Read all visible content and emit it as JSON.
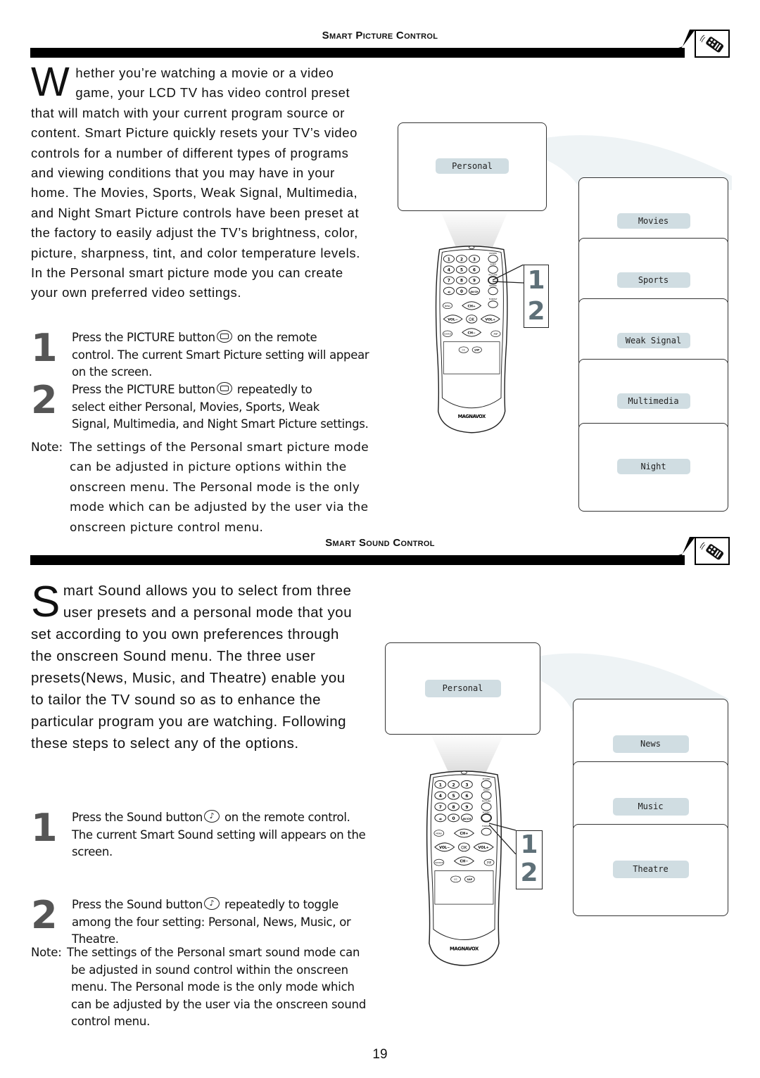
{
  "sections": {
    "picture": {
      "title": "Smart Picture Control",
      "intro_dropcap": "W",
      "intro_lines": [
        "hether you’re watching a movie or a video",
        "game, your LCD TV has video control preset",
        "that will match with your current program source or",
        "content. Smart Picture quickly resets your TV’s video",
        "controls for a number of different types of programs",
        "and viewing conditions that you may have in your",
        "home. The Movies, Sports, Weak Signal, Multimedia,",
        "and Night Smart Picture controls have been preset at",
        "the factory to easily adjust the TV’s brightness, color,",
        "picture, sharpness, tint, and color temperature levels.",
        "In the Personal smart picture mode you can create",
        "your own preferred video settings."
      ],
      "steps": [
        {
          "number": "1",
          "line1_before": "Press the PICTURE button",
          "line1_after": "on the remote",
          "rest": [
            "control. The current Smart Picture setting will appear",
            "on the screen."
          ]
        },
        {
          "number": "2",
          "line1_before": "Press the PICTURE button",
          "line1_after": "repeatedly to",
          "rest": [
            "select either Personal, Movies, Sports, Weak",
            "Signal, Multimedia, and Night Smart Picture settings."
          ]
        }
      ],
      "note_label": "Note:",
      "note_lines": [
        "The settings of the Personal smart picture mode",
        "can be adjusted in picture options within the",
        "onscreen menu. The Personal mode is the only",
        "mode which can be adjusted by the user via the",
        "onscreen picture control menu."
      ],
      "current_screen": "Personal",
      "options": [
        "Movies",
        "Sports",
        "Weak Signal",
        "Multimedia",
        "Night"
      ],
      "callout_numbers": [
        "1",
        "2"
      ],
      "button_icon": "picture-button-icon"
    },
    "sound": {
      "title": "Smart Sound Control",
      "intro_dropcap": "S",
      "intro_lines": [
        "mart Sound allows you to select from three",
        "user presets and a personal mode that you",
        "set according to you own preferences through",
        "the onscreen Sound menu. The three user",
        "presets(News, Music, and Theatre) enable you",
        "to tailor the TV sound so as to enhance the",
        "particular program you are watching. Following",
        "these steps to select any of the options."
      ],
      "steps": [
        {
          "number": "1",
          "line1_before": "Press the Sound button",
          "line1_after": "on the remote control.",
          "rest": [
            "The current Smart Sound setting will appears on the",
            "screen."
          ]
        },
        {
          "number": "2",
          "line1_before": "Press the Sound button",
          "line1_after": "repeatedly to toggle",
          "rest": [
            "among the four setting: Personal, News, Music, or",
            "Theatre."
          ]
        }
      ],
      "note_label": "Note:",
      "note_lines": [
        "The settings of the Personal smart sound mode can",
        "be adjusted in sound control within the onscreen",
        "menu. The Personal  mode is the only mode which",
        "can be adjusted by the user via the onscreen sound",
        "control menu."
      ],
      "current_screen": "Personal",
      "options": [
        "News",
        "Music",
        "Theatre"
      ],
      "callout_numbers": [
        "1",
        "2"
      ],
      "button_icon": "sound-button-icon"
    }
  },
  "remote": {
    "brand": "MAGNAVOX",
    "keys": [
      "1",
      "2",
      "3",
      "4",
      "5",
      "6",
      "7",
      "8",
      "9",
      "0",
      "AV/CH",
      "MENU",
      "CH+",
      "VOL−",
      "OK",
      "VOL+",
      "CH−",
      "SOURCE",
      "PIP",
      "CC",
      "SAP"
    ],
    "labels": [
      "POWER",
      "SLEEP",
      "PICTURE",
      "SOUND",
      "MUTE",
      "FORMAT"
    ]
  },
  "colors": {
    "pill_bg": "#d0dde2",
    "callout_num": "#5e7078",
    "swoosh": "#eef3f5",
    "bar": "#000000"
  },
  "page_number": "19"
}
